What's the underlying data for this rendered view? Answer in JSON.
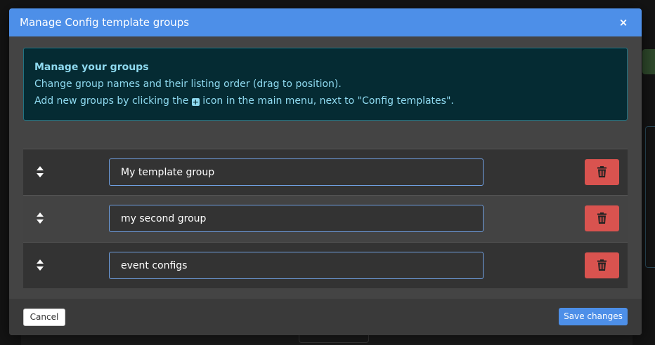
{
  "modal": {
    "title": "Manage Config template groups",
    "close_glyph": "×"
  },
  "info": {
    "title": "Manage your groups",
    "line1": "Change group names and their listing order (drag to position).",
    "line2_before": "Add new groups by clicking the ",
    "line2_icon": "plus-square-icon",
    "line2_after": " icon in the main menu, next to \"Config templates\"."
  },
  "groups": [
    {
      "name": "My template group"
    },
    {
      "name": "my second group"
    },
    {
      "name": "event configs"
    }
  ],
  "icons": {
    "drag": "sort-icon",
    "delete": "trash-icon",
    "close": "close-icon"
  },
  "footer": {
    "cancel_label": "Cancel",
    "save_label": "Save changes"
  },
  "colors": {
    "header": "#4d8fe8",
    "danger": "#d9534f",
    "info_bg": "#052b33",
    "info_text": "#8fdaf0"
  }
}
